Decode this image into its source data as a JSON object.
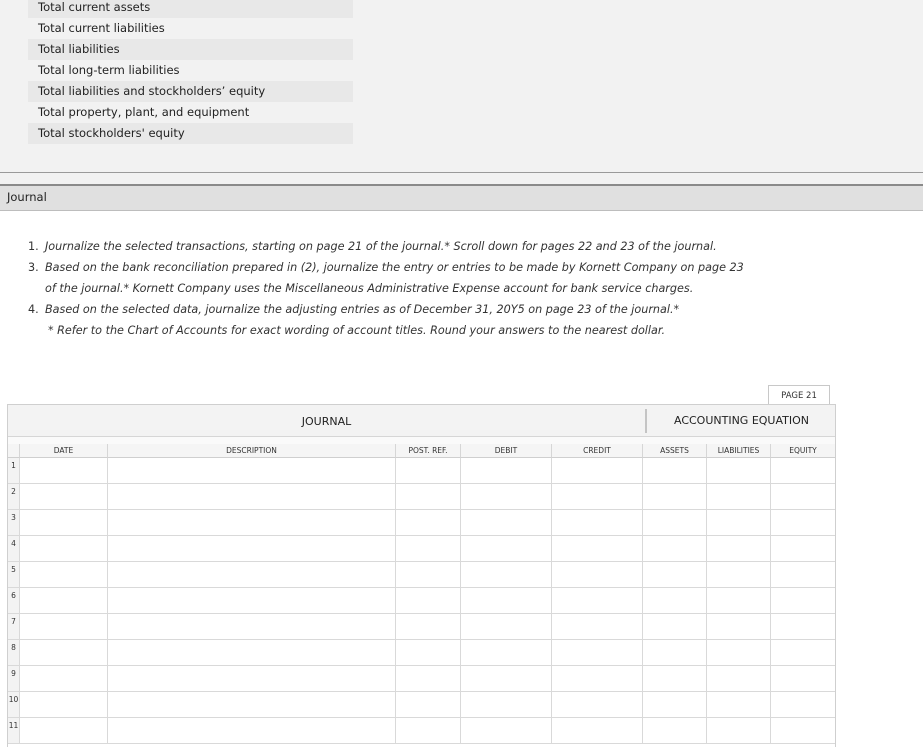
{
  "account_titles": [
    "Total current assets",
    "Total current liabilities",
    "Total liabilities",
    "Total long-term liabilities",
    "Total liabilities and stockholders’ equity",
    "Total property, plant, and equipment",
    "Total stockholders' equity"
  ],
  "section": {
    "title": "Journal"
  },
  "instructions": {
    "item1_num": "1.",
    "item1_text": "Journalize the selected transactions, starting on page 21 of the journal.* Scroll down for pages 22 and 23 of the journal.",
    "item3_num": "3.",
    "item3_text_a": "Based on the bank reconciliation prepared in (2), journalize the entry or entries to be made by Kornett Company on page 23",
    "item3_text_b": "of the journal.* Kornett Company uses the Miscellaneous Administrative Expense account for bank service charges.",
    "item4_num": "4.",
    "item4_text": "Based on the selected data, journalize the adjusting entries as of December 31, 20Y5 on page 23 of the journal.*",
    "footnote": "* Refer to the Chart of Accounts for exact wording of account titles. Round your answers to the nearest dollar."
  },
  "journal": {
    "page_label": "PAGE 21",
    "title": "JOURNAL",
    "accounting_equation": "ACCOUNTING EQUATION",
    "columns": {
      "date": "DATE",
      "description": "DESCRIPTION",
      "post_ref": "POST. REF.",
      "debit": "DEBIT",
      "credit": "CREDIT",
      "assets": "ASSETS",
      "liabilities": "LIABILITIES",
      "equity": "EQUITY"
    },
    "row_numbers": [
      "1",
      "2",
      "3",
      "4",
      "5",
      "6",
      "7",
      "8",
      "9",
      "10",
      "11"
    ]
  }
}
